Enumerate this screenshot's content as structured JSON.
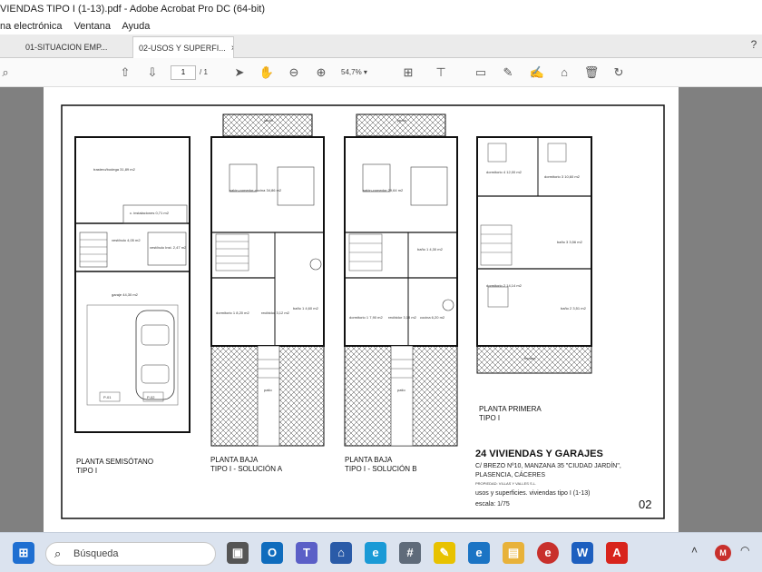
{
  "window": {
    "title": "VIENDAS TIPO I (1-13).pdf - Adobe Acrobat Pro DC (64-bit)"
  },
  "menu": {
    "items": [
      "na electrónica",
      "Ventana",
      "Ayuda"
    ]
  },
  "tabs": [
    {
      "label": "01-SITUACION EMP...",
      "active": false
    },
    {
      "label": "02-USOS Y SUPERFI...",
      "active": true,
      "close": "×"
    }
  ],
  "toolbar": {
    "page_current": "1",
    "page_total": "/ 1",
    "zoom": "54,7%",
    "icons": [
      "search-icon",
      "up-arrow-icon",
      "down-arrow-icon",
      "pointer-icon",
      "hand-icon",
      "zoom-out-icon",
      "zoom-in-icon",
      "fit-page-icon",
      "stamp-icon",
      "comment-icon",
      "pen-icon",
      "sign-icon",
      "tag-icon",
      "trash-icon",
      "rotate-icon"
    ]
  },
  "document": {
    "plans": [
      {
        "title": "PLANTA SEMISÓTANO\nTIPO I"
      },
      {
        "title": "PLANTA BAJA\nTIPO I - SOLUCIÓN A"
      },
      {
        "title": "PLANTA BAJA\nTIPO I - SOLUCIÓN B"
      },
      {
        "title": "PLANTA PRIMERA\nTIPO I"
      }
    ],
    "rooms": {
      "semisotano": [
        "trastero/bodega 31,89 m2",
        "c. instalaciones 0,71 m2",
        "vestíbulo 4,05 m2",
        "vestíbulo Inst. 2,47 m2",
        "garaje 44,30 m2",
        "P-01",
        "P-02"
      ],
      "baja_a": [
        "salón-comedor-cocina 34,86 m2",
        "dormitorio 1 8,20 m2",
        "recibidor 3,12 m2",
        "baño 1 4,60 m2",
        "patio",
        "jardín"
      ],
      "baja_b": [
        "salón-comedor 29,64 m2",
        "dormitorio 1 7,90 m2",
        "recibidor 3,18 m2",
        "cocina 6,20 m2",
        "baño 1 4,30 m2",
        "patio",
        "jardín"
      ],
      "primera": [
        "dormitorio 4 12,00 m2",
        "dormitorio 3 10,60 m2",
        "baño 3 3,56 m2",
        "dormitorio 2 14,14 m2",
        "baño 2 3,51 m2",
        "terraza"
      ]
    },
    "info": {
      "title": "24 VIVIENDAS Y GARAJES",
      "address1": "C/ BREZO Nº10, MANZANA 35 \"CIUDAD JARDÍN\",",
      "address2": "PLASENCIA, CÁCERES",
      "owner": "PROPIEDAD: VILLAS Y VALLES S.L.",
      "subject": "usos y superficies. viviendas tipo I (1-13)",
      "scale": "escala: 1/75",
      "sheet": "02"
    }
  },
  "taskbar": {
    "search_placeholder": "Búsqueda",
    "apps": [
      {
        "name": "start-icon",
        "color": "#1f6fd1"
      },
      {
        "name": "task-view-icon",
        "color": "#555555"
      },
      {
        "name": "outlook-icon",
        "color": "#0f6cbd"
      },
      {
        "name": "teams-icon",
        "color": "#5b5fc7"
      },
      {
        "name": "store-icon",
        "color": "#2a5ba8"
      },
      {
        "name": "edge-icon",
        "color": "#1a9ad6"
      },
      {
        "name": "calculator-icon",
        "color": "#5f6b7a"
      },
      {
        "name": "sticky-notes-icon",
        "color": "#e8c200"
      },
      {
        "name": "ie-icon",
        "color": "#1b74c4"
      },
      {
        "name": "file-explorer-icon",
        "color": "#e8b23a"
      },
      {
        "name": "app-red-icon",
        "color": "#c8302c"
      },
      {
        "name": "word-icon",
        "color": "#1d5fbf"
      },
      {
        "name": "acrobat-icon",
        "color": "#d8241c"
      }
    ]
  }
}
